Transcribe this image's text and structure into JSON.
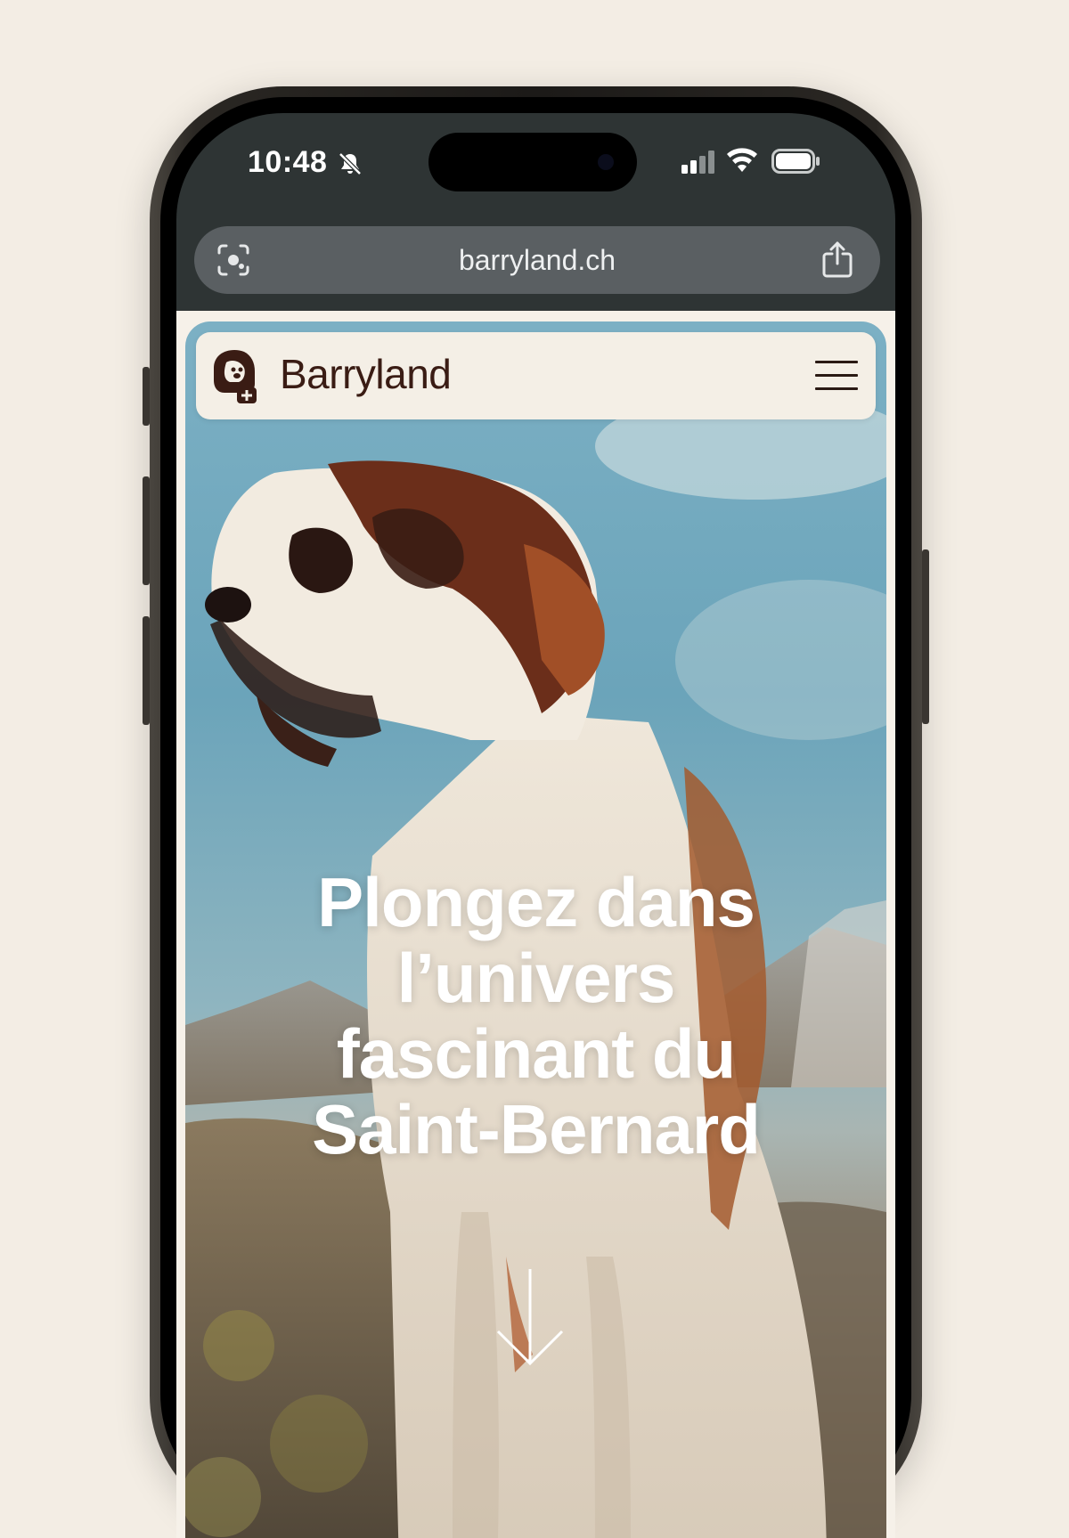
{
  "status_bar": {
    "time": "10:48",
    "icons": [
      "bell-slash-icon",
      "cellular-signal-icon",
      "wifi-icon",
      "battery-icon"
    ]
  },
  "browser": {
    "url": "barryland.ch",
    "left_icon": "visual-lookup-icon",
    "right_icon": "share-icon"
  },
  "site": {
    "brand": "Barryland",
    "logo": "saint-bernard-logo",
    "menu_icon": "hamburger-menu-icon",
    "hero_headline": [
      "Plongez dans",
      "l’univers",
      "fascinant du",
      "Saint-Bernard"
    ],
    "scroll_icon": "arrow-down-icon"
  },
  "colors": {
    "page_background": "#f3ede4",
    "brand_text": "#3a1c14",
    "browser_chrome": "#2e3434",
    "urlbar": "#5a5f62"
  }
}
